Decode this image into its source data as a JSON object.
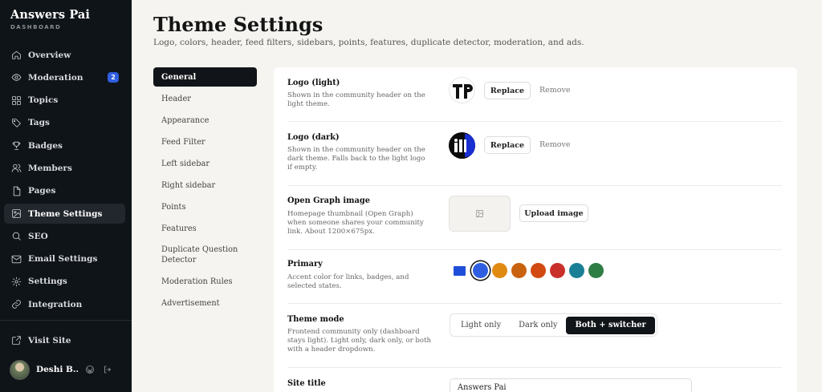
{
  "brand": {
    "title": "Answers Pai",
    "subtitle": "DASHBOARD"
  },
  "sidebar": {
    "items": [
      {
        "label": "Overview",
        "icon": "home-icon"
      },
      {
        "label": "Moderation",
        "icon": "eye-icon",
        "badge": "2"
      },
      {
        "label": "Topics",
        "icon": "grid-icon"
      },
      {
        "label": "Tags",
        "icon": "tag-icon"
      },
      {
        "label": "Badges",
        "icon": "trophy-icon"
      },
      {
        "label": "Members",
        "icon": "users-icon"
      },
      {
        "label": "Pages",
        "icon": "file-icon"
      },
      {
        "label": "Theme Settings",
        "icon": "image-icon",
        "active": true
      },
      {
        "label": "SEO",
        "icon": "search-icon"
      },
      {
        "label": "Email Settings",
        "icon": "mail-icon"
      },
      {
        "label": "Settings",
        "icon": "gear-icon"
      },
      {
        "label": "Integration",
        "icon": "link-icon"
      }
    ],
    "visit_site": "Visit Site",
    "user_name": "Deshi B..."
  },
  "header": {
    "title": "Theme Settings",
    "subtitle": "Logo, colors, header, feed filters, sidebars, points, features, duplicate detector, moderation, and ads."
  },
  "subnav": {
    "items": [
      "General",
      "Header",
      "Appearance",
      "Feed Filter",
      "Left sidebar",
      "Right sidebar",
      "Points",
      "Features",
      "Duplicate Question Detector",
      "Moderation Rules",
      "Advertisement"
    ],
    "active": "General"
  },
  "settings": {
    "logo_light": {
      "label": "Logo (light)",
      "desc": "Shown in the community header on the light theme.",
      "replace": "Replace",
      "remove": "Remove"
    },
    "logo_dark": {
      "label": "Logo (dark)",
      "desc": "Shown in the community header on the dark theme. Falls back to the light logo if empty.",
      "replace": "Replace",
      "remove": "Remove"
    },
    "og_image": {
      "label": "Open Graph image",
      "desc": "Homepage thumbnail (Open Graph) when someone shares your community link. About 1200×675px.",
      "upload": "Upload image"
    },
    "primary": {
      "label": "Primary",
      "desc": "Accent color for links, badges, and selected states.",
      "current": "#1f4fd8",
      "swatches": [
        "#2f5fe0",
        "#e08a12",
        "#c9620f",
        "#d14a12",
        "#c9302c",
        "#1a7f95",
        "#2e7d45"
      ],
      "selected_index": 0
    },
    "theme_mode": {
      "label": "Theme mode",
      "desc": "Frontend community only (dashboard stays light). Light only, dark only, or both with a header dropdown.",
      "options": [
        "Light only",
        "Dark only",
        "Both + switcher"
      ],
      "selected": "Both + switcher"
    },
    "site_title": {
      "label": "Site title",
      "value": "Answers Pai"
    }
  }
}
